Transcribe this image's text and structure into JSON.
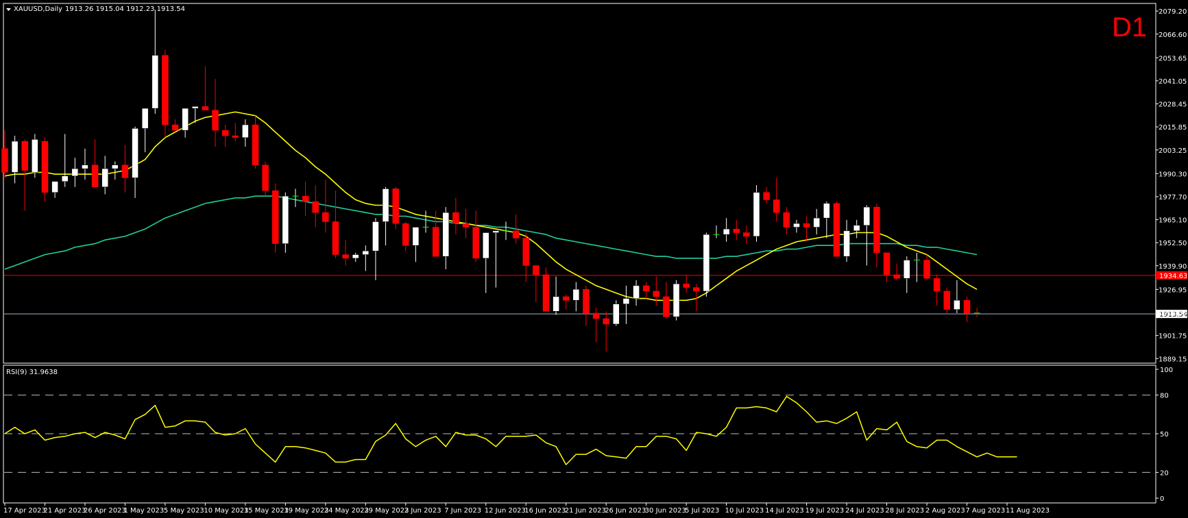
{
  "header": {
    "symbol": "XAUUSD,Daily",
    "ohlc": "1913.26 1915.04 1912.23 1913.54",
    "timeframe": "D1"
  },
  "rsi_panel": {
    "label": "RSI(9) 31.9638",
    "levels": [
      20,
      50,
      80
    ],
    "axis_labels": [
      "100",
      "80",
      "50",
      "20",
      "0"
    ]
  },
  "price_lines": {
    "red_level": 1934.63,
    "red_level_label": "1934.63",
    "current": 1913.54,
    "current_label": "1913.54"
  },
  "colors": {
    "background": "#000000",
    "bull": "#ffffff",
    "bear": "#ff0000",
    "ma_fast": "#ffff00",
    "ma_slow": "#20d0a0",
    "rsi": "#ffff00",
    "red_line": "#ff0000",
    "current_line": "#a0b4c8",
    "axis": "#ffffff"
  },
  "chart_data": [
    {
      "type": "candlestick",
      "price_ticks": [
        "2079.20",
        "2066.60",
        "2053.65",
        "2041.05",
        "2028.45",
        "2015.85",
        "2003.25",
        "1990.30",
        "1977.70",
        "1965.10",
        "1952.50",
        "1939.90",
        "1926.95",
        "1914.35",
        "1901.75",
        "1889.15"
      ],
      "ylim": [
        1887,
        2083
      ],
      "date_labels": [
        "17 Apr 2023",
        "21 Apr 2023",
        "26 Apr 2023",
        "1 May 2023",
        "5 May 2023",
        "10 May 2023",
        "15 May 2023",
        "19 May 2023",
        "24 May 2023",
        "29 May 2023",
        "2 Jun 2023",
        "7 Jun 2023",
        "12 Jun 2023",
        "16 Jun 2023",
        "21 Jun 2023",
        "26 Jun 2023",
        "30 Jun 2023",
        "5 Jul 2023",
        "10 Jul 2023",
        "14 Jul 2023",
        "19 Jul 2023",
        "24 Jul 2023",
        "28 Jul 2023",
        "2 Aug 2023",
        "7 Aug 2023",
        "11 Aug 2023"
      ],
      "date_label_bar_index": [
        0,
        4,
        8,
        12,
        16,
        20,
        24,
        28,
        32,
        36,
        40,
        44,
        48,
        52,
        56,
        60,
        64,
        68,
        72,
        76,
        80,
        84,
        88,
        92,
        96,
        100
      ],
      "candles": [
        [
          2004,
          2014,
          1988,
          1991
        ],
        [
          1991,
          2011,
          1985,
          2008
        ],
        [
          2008,
          2009,
          1970,
          1992
        ],
        [
          1991,
          2012,
          1988,
          2009
        ],
        [
          2008,
          2010,
          1975,
          1980
        ],
        [
          1980,
          1986,
          1977,
          1986
        ],
        [
          1986,
          2012,
          1983,
          1989
        ],
        [
          1989,
          1999,
          1983,
          1993
        ],
        [
          1993,
          2004,
          1987,
          1995
        ],
        [
          1995,
          2009,
          1987,
          1983
        ],
        [
          1983,
          2000,
          1979,
          1993
        ],
        [
          1993,
          1997,
          1987,
          1995
        ],
        [
          1995,
          2006,
          1980,
          1988
        ],
        [
          1988,
          2016,
          1977,
          2015
        ],
        [
          2015,
          2024,
          2002,
          2026
        ],
        [
          2026,
          2080,
          2023,
          2055
        ],
        [
          2055,
          2058,
          2010,
          2017
        ],
        [
          2017,
          2020,
          2014,
          2014
        ],
        [
          2014,
          2026,
          2010,
          2026
        ],
        [
          2026,
          2027,
          2018,
          2027
        ],
        [
          2027,
          2049,
          2025,
          2025
        ],
        [
          2025,
          2042,
          2005,
          2014
        ],
        [
          2014,
          2017,
          2005,
          2011
        ],
        [
          2011,
          2018,
          2008,
          2010
        ],
        [
          2010,
          2020,
          2005,
          2017
        ],
        [
          2017,
          2022,
          1993,
          1995
        ],
        [
          1995,
          1997,
          1978,
          1981
        ],
        [
          1981,
          1985,
          1947,
          1952
        ],
        [
          1952,
          1980,
          1947,
          1978
        ],
        [
          1978,
          1982,
          1972,
          1978
        ],
        [
          1978,
          1986,
          1967,
          1975
        ],
        [
          1975,
          1984,
          1961,
          1969
        ],
        [
          1969,
          1987,
          1958,
          1964
        ],
        [
          1964,
          1981,
          1944,
          1946
        ],
        [
          1946,
          1954,
          1940,
          1944
        ],
        [
          1944,
          1947,
          1942,
          1946
        ],
        [
          1946,
          1951,
          1937,
          1948
        ],
        [
          1948,
          1966,
          1932,
          1964
        ],
        [
          1964,
          1983,
          1951,
          1982
        ],
        [
          1982,
          1983,
          1960,
          1963
        ],
        [
          1963,
          1964,
          1948,
          1951
        ],
        [
          1951,
          1961,
          1942,
          1961
        ],
        [
          1961,
          1970,
          1958,
          1961
        ],
        [
          1961,
          1970,
          1945,
          1945
        ],
        [
          1945,
          1972,
          1938,
          1969
        ],
        [
          1969,
          1977,
          1957,
          1963
        ],
        [
          1963,
          1971,
          1955,
          1961
        ],
        [
          1961,
          1970,
          1942,
          1944
        ],
        [
          1944,
          1957,
          1925,
          1958
        ],
        [
          1958,
          1959,
          1928,
          1959
        ],
        [
          1959,
          1964,
          1954,
          1959
        ],
        [
          1959,
          1968,
          1952,
          1955
        ],
        [
          1955,
          1958,
          1931,
          1940
        ],
        [
          1940,
          1940,
          1920,
          1935
        ],
        [
          1935,
          1939,
          1915,
          1915
        ],
        [
          1915,
          1934,
          1913,
          1923
        ],
        [
          1923,
          1924,
          1916,
          1921
        ],
        [
          1921,
          1931,
          1915,
          1927
        ],
        [
          1927,
          1929,
          1907,
          1914
        ],
        [
          1914,
          1917,
          1898,
          1911
        ],
        [
          1911,
          1915,
          1893,
          1908
        ],
        [
          1908,
          1921,
          1907,
          1919
        ],
        [
          1919,
          1929,
          1908,
          1922
        ],
        [
          1922,
          1932,
          1918,
          1929
        ],
        [
          1929,
          1931,
          1922,
          1926
        ],
        [
          1926,
          1934,
          1918,
          1923
        ],
        [
          1923,
          1931,
          1911,
          1912
        ],
        [
          1912,
          1932,
          1910,
          1930
        ],
        [
          1930,
          1935,
          1925,
          1928
        ],
        [
          1928,
          1930,
          1915,
          1926
        ],
        [
          1926,
          1958,
          1923,
          1957
        ],
        [
          1957,
          1962,
          1955,
          1957
        ],
        [
          1957,
          1966,
          1953,
          1960
        ],
        [
          1960,
          1965,
          1954,
          1958
        ],
        [
          1958,
          1962,
          1952,
          1956
        ],
        [
          1956,
          1984,
          1953,
          1980
        ],
        [
          1980,
          1983,
          1974,
          1976
        ],
        [
          1976,
          1988,
          1964,
          1969
        ],
        [
          1969,
          1972,
          1957,
          1961
        ],
        [
          1961,
          1965,
          1958,
          1963
        ],
        [
          1963,
          1967,
          1953,
          1961
        ],
        [
          1961,
          1971,
          1957,
          1966
        ],
        [
          1966,
          1975,
          1955,
          1974
        ],
        [
          1974,
          1975,
          1947,
          1945
        ],
        [
          1945,
          1965,
          1942,
          1959
        ],
        [
          1959,
          1965,
          1955,
          1962
        ],
        [
          1962,
          1973,
          1940,
          1972
        ],
        [
          1972,
          1974,
          1939,
          1947
        ],
        [
          1947,
          1947,
          1931,
          1935
        ],
        [
          1935,
          1941,
          1932,
          1933
        ],
        [
          1933,
          1945,
          1925,
          1943
        ],
        [
          1943,
          1947,
          1931,
          1943
        ],
        [
          1943,
          1946,
          1932,
          1933
        ],
        [
          1933,
          1935,
          1918,
          1926
        ],
        [
          1926,
          1928,
          1914,
          1916
        ],
        [
          1916,
          1932,
          1914,
          1921
        ],
        [
          1921,
          1923,
          1909,
          1914
        ],
        [
          1914,
          1917,
          1912,
          1913.54
        ]
      ],
      "ma_fast": [
        1989,
        1990,
        1990,
        1991,
        1991,
        1990,
        1990,
        1990,
        1990,
        1990,
        1990,
        1991,
        1992,
        1995,
        1998,
        2005,
        2010,
        2013,
        2016,
        2019,
        2021,
        2022,
        2023,
        2024,
        2023,
        2022,
        2018,
        2013,
        2008,
        2003,
        1999,
        1994,
        1990,
        1985,
        1980,
        1976,
        1974,
        1973,
        1973,
        1972,
        1970,
        1968,
        1967,
        1966,
        1965,
        1964,
        1963,
        1962,
        1961,
        1960,
        1959,
        1958,
        1956,
        1952,
        1947,
        1942,
        1938,
        1935,
        1932,
        1929,
        1927,
        1925,
        1923,
        1922,
        1922,
        1921,
        1921,
        1921,
        1921,
        1922,
        1925,
        1929,
        1933,
        1937,
        1940,
        1943,
        1946,
        1949,
        1951,
        1953,
        1954,
        1955,
        1956,
        1957,
        1957,
        1958,
        1958,
        1958,
        1956,
        1953,
        1950,
        1948,
        1946,
        1942,
        1938,
        1934,
        1930,
        1927
      ],
      "ma_slow": [
        1938,
        1940,
        1942,
        1944,
        1946,
        1947,
        1948,
        1950,
        1951,
        1952,
        1954,
        1955,
        1956,
        1958,
        1960,
        1963,
        1966,
        1968,
        1970,
        1972,
        1974,
        1975,
        1976,
        1977,
        1977,
        1978,
        1978,
        1978,
        1977,
        1976,
        1975,
        1974,
        1973,
        1972,
        1971,
        1970,
        1969,
        1968,
        1968,
        1967,
        1967,
        1966,
        1965,
        1964,
        1964,
        1963,
        1963,
        1962,
        1962,
        1961,
        1961,
        1960,
        1959,
        1958,
        1957,
        1955,
        1954,
        1953,
        1952,
        1951,
        1950,
        1949,
        1948,
        1947,
        1946,
        1945,
        1945,
        1944,
        1944,
        1944,
        1944,
        1944,
        1945,
        1945,
        1946,
        1947,
        1948,
        1948,
        1949,
        1949,
        1950,
        1951,
        1951,
        1951,
        1952,
        1952,
        1952,
        1952,
        1952,
        1952,
        1951,
        1951,
        1950,
        1950,
        1949,
        1948,
        1947,
        1946
      ]
    },
    {
      "type": "line",
      "name": "RSI(9)",
      "ylim": [
        0,
        100
      ],
      "values": [
        50,
        55,
        50,
        53,
        45,
        47,
        48,
        50,
        51,
        47,
        51,
        49,
        46,
        61,
        65,
        72,
        55,
        56,
        60,
        60,
        59,
        51,
        49,
        50,
        54,
        42,
        35,
        28,
        40,
        40,
        39,
        37,
        35,
        28,
        28,
        30,
        30,
        44,
        49,
        58,
        46,
        40,
        45,
        48,
        40,
        51,
        49,
        49,
        46,
        40,
        48,
        48,
        48,
        49,
        43,
        40,
        26,
        34,
        34,
        38,
        33,
        32,
        31,
        40,
        40,
        48,
        48,
        46,
        37,
        51,
        50,
        48,
        55,
        70,
        70,
        71,
        70,
        67,
        79,
        74,
        67,
        59,
        60,
        58,
        62,
        67,
        45,
        54,
        53,
        59,
        44,
        40,
        39,
        45,
        45,
        40,
        36,
        32,
        35,
        32,
        32,
        32
      ]
    }
  ]
}
